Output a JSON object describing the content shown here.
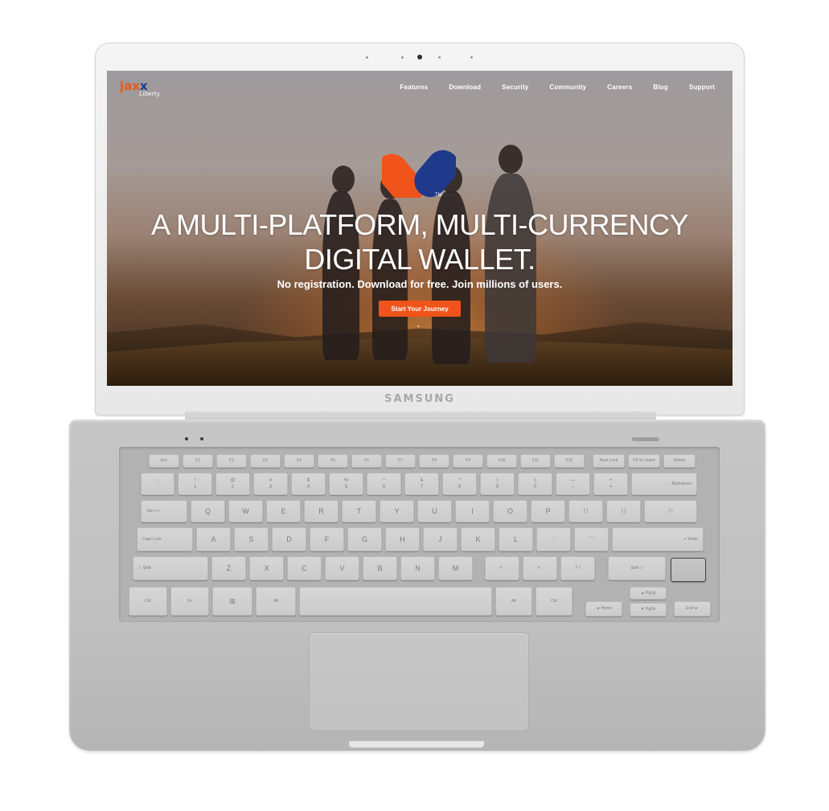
{
  "device": {
    "brand": "SAMSUNG"
  },
  "site": {
    "logo_main": "jax",
    "logo_accent": "x",
    "logo_sub": "Liberty",
    "nav": [
      {
        "label": "Features"
      },
      {
        "label": "Download"
      },
      {
        "label": "Security"
      },
      {
        "label": "Community"
      },
      {
        "label": "Careers"
      },
      {
        "label": "Blog"
      },
      {
        "label": "Support"
      }
    ],
    "hero": {
      "headline_line1": "A MULTI-PLATFORM, MULTI-CURRENCY",
      "headline_line2": "DIGITAL WALLET.",
      "tm": "TM",
      "subline": "No registration. Download for free. Join millions of users.",
      "cta": "Start Your Journey",
      "scroll_glyph": "⌄"
    },
    "colors": {
      "accent_orange": "#f0541a",
      "accent_blue": "#1f3a8a"
    }
  },
  "keyboard": {
    "row_fn": [
      "Esc",
      "F1",
      "F2",
      "F3",
      "F4",
      "F5",
      "F6",
      "F7",
      "F8",
      "F9",
      "F10",
      "F11",
      "F12",
      "Num Lock",
      "Prt Sc Insert",
      "Delete"
    ],
    "row_num": [
      {
        "top": "~",
        "bottom": "`"
      },
      {
        "top": "!",
        "bottom": "1"
      },
      {
        "top": "@",
        "bottom": "2"
      },
      {
        "top": "#",
        "bottom": "3"
      },
      {
        "top": "$",
        "bottom": "4"
      },
      {
        "top": "%",
        "bottom": "5"
      },
      {
        "top": "^",
        "bottom": "6"
      },
      {
        "top": "&",
        "bottom": "7"
      },
      {
        "top": "*",
        "bottom": "8"
      },
      {
        "top": "(",
        "bottom": "9"
      },
      {
        "top": ")",
        "bottom": "0"
      },
      {
        "top": "—",
        "bottom": "–"
      },
      {
        "top": "+",
        "bottom": "="
      },
      {
        "top": "",
        "bottom": "← Backspace"
      }
    ],
    "row_q": [
      "Tab ⟷",
      "Q",
      "W",
      "E",
      "R",
      "T",
      "Y",
      "U",
      "I",
      "O",
      "P",
      "{ [",
      "} ]",
      "| \\"
    ],
    "row_a": [
      "Caps Lock",
      "A",
      "S",
      "D",
      "F",
      "G",
      "H",
      "J",
      "K",
      "L",
      ": ;",
      "\" '",
      "↵ Enter"
    ],
    "row_z": [
      "⇧ Shift",
      "Z",
      "X",
      "C",
      "V",
      "B",
      "N",
      "M",
      "< ,",
      "> .",
      "? /",
      "Shift ⇧"
    ],
    "row_bottom": [
      "Ctrl",
      "Fn",
      "⊞",
      "Alt",
      "",
      "Alt",
      "Ctrl",
      "◄ Home",
      "▲ PgUp",
      "▼ PgDn",
      "End ►"
    ]
  }
}
